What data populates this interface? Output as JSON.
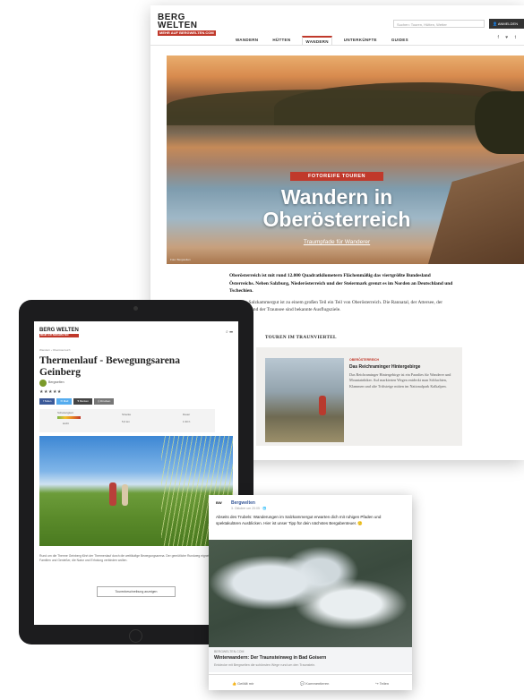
{
  "desktop": {
    "logo": {
      "line1": "BERG",
      "line2": "WELTEN",
      "tagline": "MEHR AUF BERGWELTEN.COM"
    },
    "search_placeholder": "Suchen: Touren, Hütten, Wetter",
    "login_label": "ANMELDEN",
    "nav": [
      "WANDERN",
      "HÜTTEN",
      "WANDERN",
      "UNTERKÜNFTE",
      "GUIDES"
    ],
    "nav_active_index": 2,
    "social": "f  ♥  t",
    "hero": {
      "kicker": "FOTOREIFE TOUREN",
      "title_line1": "Wandern in",
      "title_line2": "Oberösterreich",
      "link": "Traumpfade für Wanderer",
      "credit": "Foto: Bergwelten"
    },
    "intro_p1_bold": "Oberösterreich ist mit rund 12.000 Quadratkilometern Flächenmäßig das viertgrößte Bundesland Österreichs. Neben Salzburg, Niederösterreich und der Steiermark grenzt es im Norden an Deutschland und Tschechien.",
    "intro_p2": "Auch das Salzkammergut ist zu einem großen Teil ein Teil von Oberösterreich. Die Rannatal, der Attersee, der Traunstein und der Traunsee sind bekannte Ausflugsziele.",
    "trau_heading": "TOUREN IM TRAUNVIERTEL",
    "teaser": {
      "kicker": "OBERÖSTERREICH",
      "title": "Das Reichraminger Hintergebirge",
      "text": "Das Reichraminger Hintergebirge ist ein Paradies für Wanderer und Mountainbiker. Auf markierten Wegen entdeckt man Schluchten, Klammen und alte Triftsteige mitten im Nationalpark Kalkalpen."
    }
  },
  "tablet": {
    "logo": "BERG WELTEN",
    "logo_sub": "MEHR AUF BERGWELTEN",
    "icons": "⌕ ☰",
    "breadcrumb": "Wandern › Oberösterreich",
    "title": "Thermenlauf - Bewegungsarena Geinberg",
    "author": "Bergwelten",
    "stars": "★★★★★",
    "share": [
      "f Teilen",
      "✉ Mail",
      "♥ Merken",
      "⎙ Drucken"
    ],
    "stats": {
      "label1": "Schwierigkeit",
      "label2": "Strecke",
      "val2": "5,6 km",
      "label3": "Dauer",
      "val3": "1:30 h",
      "diff": "leicht"
    },
    "body": "Rund um die Therme Geinberg führt der Thermenlauf durch die weitläufige Bewegungsarena. Der gemütliche Rundweg eignet sich ideal für Familien und Genießer, die Natur und Erholung verbinden wollen.",
    "button": "Tourenbeschreibung anzeigen"
  },
  "facebook": {
    "avatar": "BW",
    "name": "Bergwelten",
    "time": "3. Oktober um 20:05 · 🌐",
    "text": "Abseits des Trubels: Wanderungen im Salzkammergut erwarten dich mit ruhigen Pfaden und spektakulären Ausblicken. Hier ist unser Tipp für dein nächstes Bergabenteuer. 🙂",
    "card": {
      "url": "BERGWELTEN.COM",
      "title": "Winterwandern: Der Traunsteinweg in Bad Goisern",
      "desc": "Entdecke mit Bergwelten die schönsten Wege rund um den Traunstein."
    },
    "actions": [
      "👍 Gefällt mir",
      "💬 Kommentieren",
      "↪ Teilen"
    ]
  }
}
